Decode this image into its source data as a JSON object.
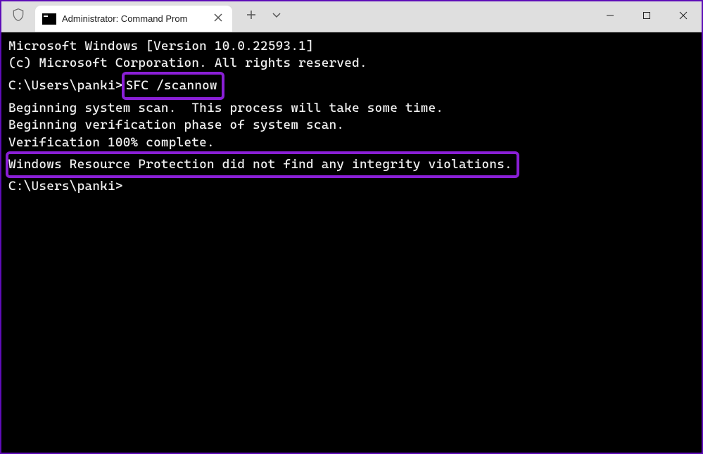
{
  "tab": {
    "title": "Administrator: Command Prom"
  },
  "terminal": {
    "line1": "Microsoft Windows [Version 10.0.22593.1]",
    "line2": "(c) Microsoft Corporation. All rights reserved.",
    "blank1": "",
    "prompt1_prefix": "C:\\Users\\panki>",
    "command1": "SFC /scannow",
    "blank2": "",
    "line3": "Beginning system scan.  This process will take some time.",
    "blank3": "",
    "line4": "Beginning verification phase of system scan.",
    "line5": "Verification 100% complete.",
    "blank4": "",
    "result": "Windows Resource Protection did not find any integrity violations.",
    "blank5": "",
    "prompt2": "C:\\Users\\panki>"
  },
  "colors": {
    "highlight_border": "#8a1fd6",
    "terminal_bg": "#000000",
    "terminal_fg": "#f0f0f0"
  }
}
